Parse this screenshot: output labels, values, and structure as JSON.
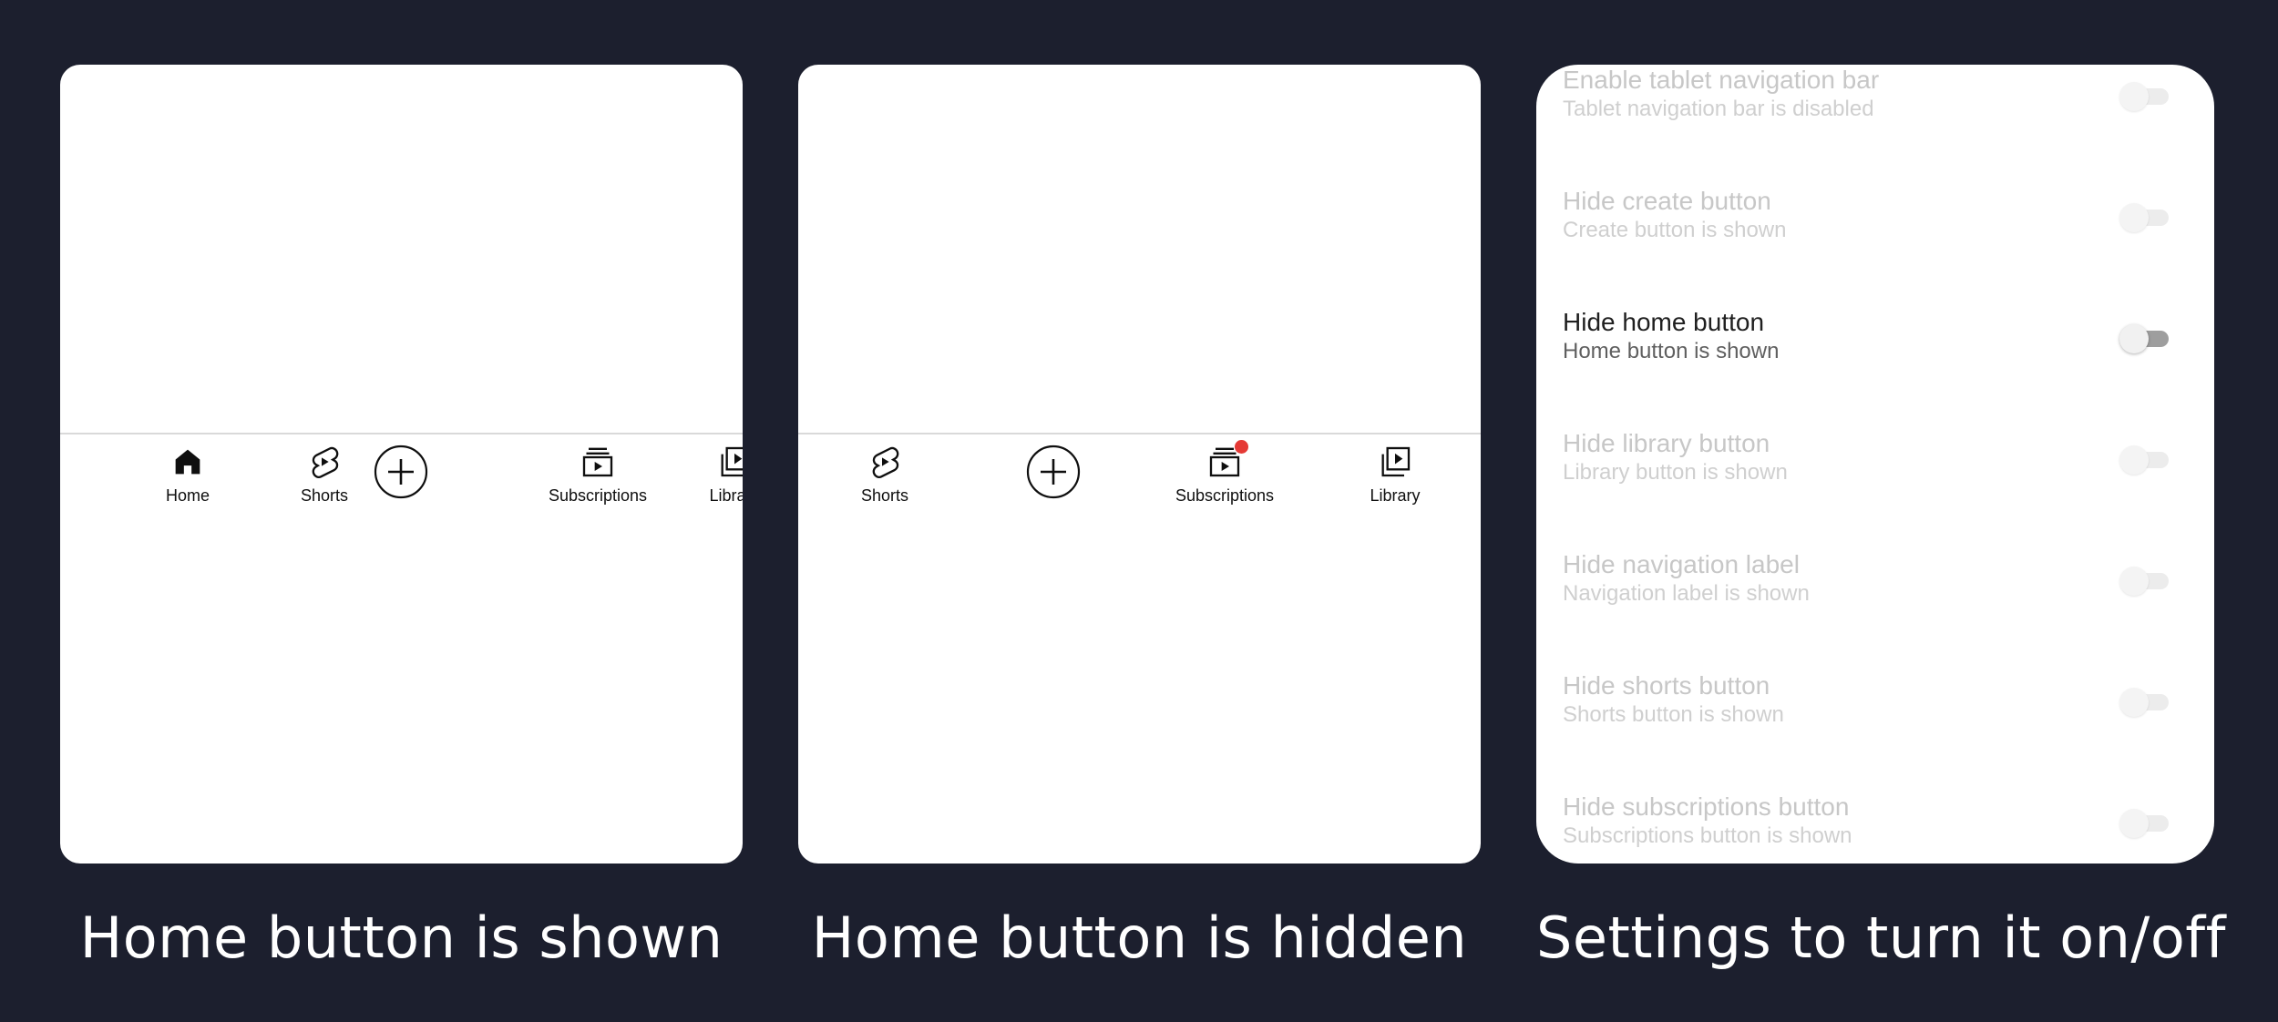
{
  "captions": {
    "panel1": "Home button is shown",
    "panel2": "Home button is hidden",
    "panel3": "Settings to turn it on/off"
  },
  "panel1": {
    "nav": [
      {
        "label": "Home",
        "icon": "home-icon"
      },
      {
        "label": "Shorts",
        "icon": "shorts-icon"
      },
      {
        "label": "",
        "icon": "create-icon"
      },
      {
        "label": "Subscriptions",
        "icon": "subscriptions-icon"
      },
      {
        "label": "Library",
        "icon": "library-icon"
      }
    ]
  },
  "panel2": {
    "nav": [
      {
        "label": "Shorts",
        "icon": "shorts-icon"
      },
      {
        "label": "",
        "icon": "create-icon"
      },
      {
        "label": "Subscriptions",
        "icon": "subscriptions-icon",
        "badge": true
      },
      {
        "label": "Library",
        "icon": "library-icon"
      }
    ]
  },
  "settings": [
    {
      "title": "Enable tablet navigation bar",
      "summary": "Tablet navigation bar is disabled",
      "on": false,
      "active": false
    },
    {
      "title": "Hide create button",
      "summary": "Create button is shown",
      "on": false,
      "active": false
    },
    {
      "title": "Hide home button",
      "summary": "Home button is shown",
      "on": false,
      "active": true
    },
    {
      "title": "Hide library button",
      "summary": "Library button is shown",
      "on": false,
      "active": false
    },
    {
      "title": "Hide navigation label",
      "summary": "Navigation label is shown",
      "on": false,
      "active": false
    },
    {
      "title": "Hide shorts button",
      "summary": "Shorts button is shown",
      "on": false,
      "active": false
    },
    {
      "title": "Hide subscriptions button",
      "summary": "Subscriptions button is shown",
      "on": false,
      "active": false
    }
  ],
  "colors": {
    "background": "#1c1f2e",
    "panel": "#ffffff",
    "badge": "#e53935",
    "toggle_active_track": "#9e9e9e"
  }
}
